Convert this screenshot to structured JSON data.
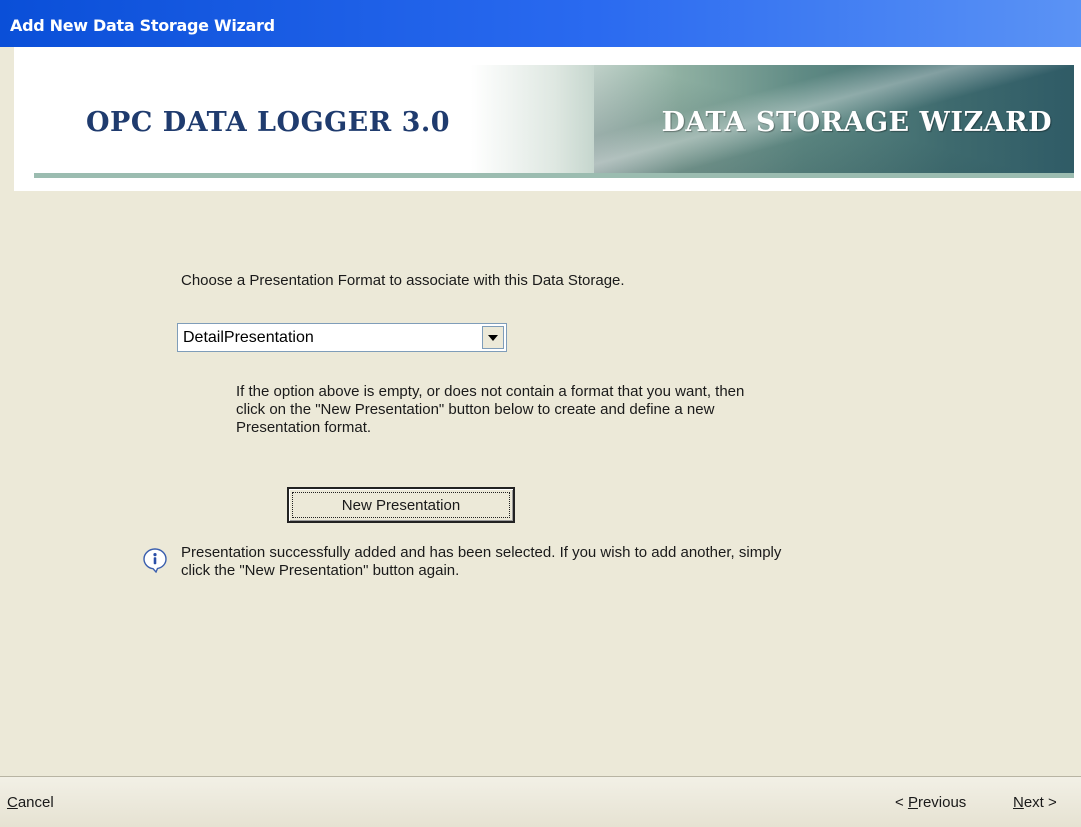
{
  "window": {
    "title": "Add New Data Storage Wizard"
  },
  "banner": {
    "product_name": "OPC DATA LOGGER 3.0",
    "wizard_name": "DATA STORAGE WIZARD"
  },
  "content": {
    "instruction": "Choose a Presentation Format to associate with this Data Storage.",
    "format_select": {
      "value": "DetailPresentation"
    },
    "help_text": "If the option above is empty, or does not contain a format that you want, then click on the \"New Presentation\" button below to create and define a new Presentation format.",
    "new_presentation_label": "New Presentation",
    "status_message": "Presentation successfully added and has been selected. If you wish to add another, simply click the \"New Presentation\" button again."
  },
  "footer": {
    "cancel_label": "Cancel",
    "previous_label": "< Previous",
    "next_label": "Next >"
  },
  "colors": {
    "titlebar": "#0a4fd8",
    "product_text": "#1f3b6e",
    "banner_accent": "#3e6a6e",
    "dialog_background": "#ece9d8"
  },
  "icons": {
    "status": "info-icon",
    "dropdown": "chevron-down-icon"
  }
}
